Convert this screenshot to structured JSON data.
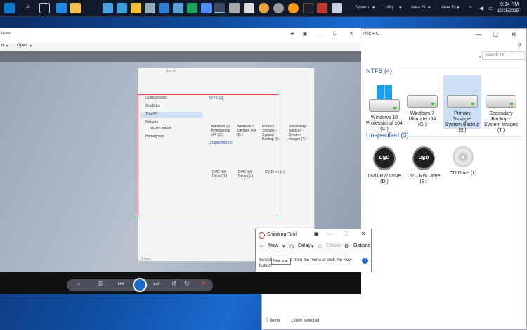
{
  "taskbar": {
    "tray_labels": [
      "System",
      "Utility",
      "Area 51",
      "Area 52"
    ],
    "clock_time": "9:34 PM",
    "clock_date": "10/25/2015",
    "icons": [
      "start-icon",
      "search-icon",
      "task-view-icon",
      "ie-icon",
      "explorer-icon",
      "mail-icon",
      "media-icon",
      "folder-icon",
      "calc-icon",
      "tool-icon",
      "settings-icon",
      "firefox-icon",
      "edge-icon",
      "snipping-icon",
      "pin-icon",
      "chrome-icon",
      "vlc-icon",
      "archive-icon",
      "shield-icon",
      "network-icon",
      "app-icon",
      "recycle-icon"
    ]
  },
  "explorer": {
    "title": "This PC",
    "search_placeholder": "Search Th...",
    "group_ntfs": "NTFS (4)",
    "group_unspecified": "Unspecified (3)",
    "ntfs_drives": [
      "Windows 10 Professional x64 (C:)",
      "Windows 7 Ultimate x64 (G:)",
      "Primary Storage- System Backup (S:)",
      "Secondary Backup - System Images (T:)"
    ],
    "other_drives": [
      "DVD RW Drive (D:)",
      "DVD RW Drive (E:)",
      "CD Drive (I:)"
    ],
    "dvd_label": "DVD",
    "status_items": "7 items",
    "status_selected": "1 item selected"
  },
  "viewer": {
    "title": "iewer",
    "menu": [
      "n",
      "Open"
    ],
    "status": "1 item",
    "mini": {
      "title": "This PC",
      "sidebar": [
        "Quick access",
        "OneDrive",
        "This PC",
        "Network",
        "Homegroup"
      ],
      "net_child": "NIGHT-HAWK",
      "group_ntfs": "NTFS (4)",
      "group_unspecified": "Unspecified (3)",
      "drives": [
        "Windows 10 Professional x64 (C:)",
        "Windows 7 Ultimate x64 (G:)",
        "Primary Storage - System Backup (S:)",
        "Secondary Backup - System Images (T:)"
      ],
      "other": [
        "DVD RW Drive (D:)",
        "DVD RW Drive (E:)",
        "CD Drive (I:)"
      ]
    }
  },
  "snipping": {
    "title": "Snipping Tool",
    "new": "New",
    "delay": "Delay",
    "cancel": "Cancel",
    "options": "Options",
    "message": "Select a snip type from the menu or click the New button.",
    "tooltip": "New snip"
  }
}
